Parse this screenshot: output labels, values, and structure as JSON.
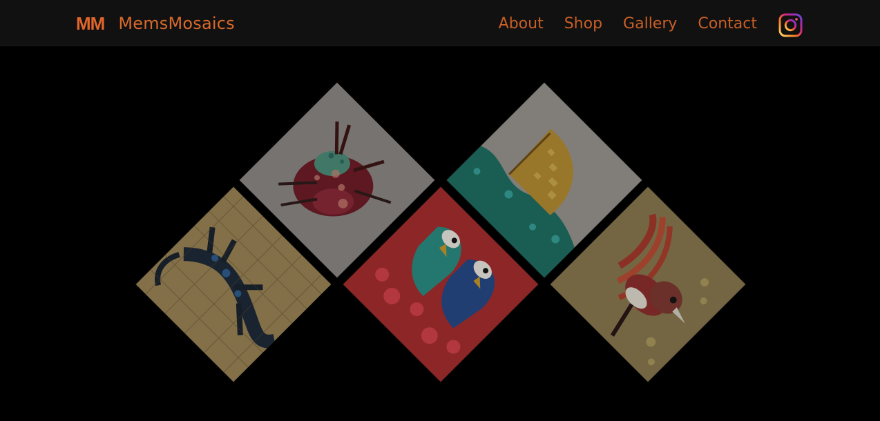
{
  "brand": {
    "mark": "MM",
    "name": "MemsMosaics"
  },
  "navigation": {
    "links": [
      {
        "label": "About"
      },
      {
        "label": "Shop"
      },
      {
        "label": "Gallery"
      },
      {
        "label": "Contact"
      }
    ],
    "social_icon": "instagram-icon"
  },
  "gallery": {
    "tiles": [
      {
        "subject": "beetle-mosaic"
      },
      {
        "subject": "sailboat-mosaic"
      },
      {
        "subject": "gecko-mosaic"
      },
      {
        "subject": "birds-mosaic"
      },
      {
        "subject": "robin-mosaic"
      }
    ]
  },
  "colors": {
    "accent": "#d96a2b",
    "nav_background": "#111111",
    "page_background": "#000000"
  }
}
